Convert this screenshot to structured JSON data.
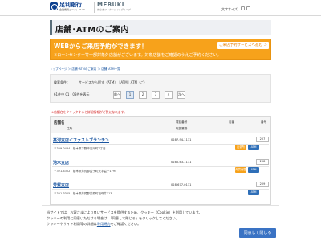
{
  "header": {
    "bank_name": "足利銀行",
    "bank_sub": "金融機関コード：0129",
    "group_name": "MEBUKI",
    "group_sub": "めぶきフィナンシャルグループ",
    "site_links": "文字サイズ"
  },
  "page": {
    "title": "店舗･ATMのご案内"
  },
  "promo": {
    "line1": "WEBからご来店予約ができます！",
    "line2": "※ローンセンター等一部対象外店舗がございます。対象店舗をご確認のうえご予約ください。",
    "button": "ご来店予約サービスへ進む ＞"
  },
  "breadcrumb": "トップページ ＞ 店舗･ATMのご案内 ＞ 店舗･ATM一覧",
  "search": {
    "condition_label": "検索条件：",
    "condition_value": "サービスから探す（ATM）｜ATM｜ATM（ご）",
    "result_label": "検索結果：",
    "result_value": "61件中 01 - 08件を表示",
    "pages": [
      "前へ",
      "1",
      "2",
      "3",
      "4",
      "次へ"
    ]
  },
  "note": "※店舗名をクリックすると詳細情報がご覧になれます。",
  "table": {
    "headers": {
      "name": "店舗名",
      "address": "住所",
      "tel": "電話番号",
      "hours": "取扱業務",
      "number": "店番",
      "count": "番号"
    },
    "rows": [
      {
        "title": "高河支店＜ファストブランチ＞",
        "tel": "0287-94-1111",
        "code": "207",
        "address": "〒329-0434　栃木県下野市高河町2丁目",
        "badge_a": "出張所",
        "badge_b": "ATM"
      },
      {
        "title": "池木支店",
        "tel": "0285-63-1111",
        "code": "208",
        "address": "〒321-4302　栃木県芳賀郡益子町大字益子1795",
        "badge_a": "外貨両替",
        "badge_b": "ATM"
      },
      {
        "title": "芳賀支店",
        "tel": "028-677-0111",
        "code": "209",
        "address": "〒321-3305　栃木県芳賀郡芳賀町祖母井113",
        "badge_a": "",
        "badge_b": "ATM"
      }
    ]
  },
  "cookie": {
    "line1": "当サイトでは、お客さまにより良いサービスを提供するため、クッキー（Cookie）を利用しています。",
    "line2": "クッキーの利用に同意いただける場合は、「同意して閉じる」をクリックしてください。",
    "line3": "クッキーやサイト利用等の詳細は",
    "link": "利用規約",
    "line3_end": "をご確認ください。",
    "button": "同意して閉じる"
  }
}
